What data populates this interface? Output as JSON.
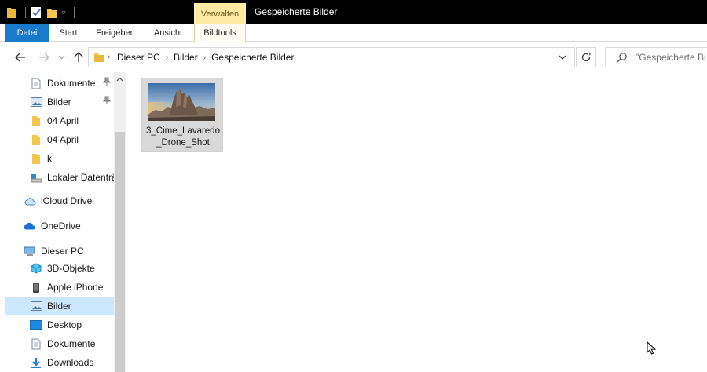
{
  "window": {
    "title": "Gespeicherte Bilder",
    "context_tab": "Verwalten",
    "accent_color": "#1979ca",
    "context_tab_color": "#ffeaa3",
    "selected_nav_color": "#cce8ff"
  },
  "ribbon": {
    "tabs": [
      {
        "label": "Datei",
        "icon": "none"
      },
      {
        "label": "Start",
        "icon": "none"
      },
      {
        "label": "Freigeben",
        "icon": "none"
      },
      {
        "label": "Ansicht",
        "icon": "none"
      },
      {
        "label": "Bildtools",
        "icon": "none"
      }
    ]
  },
  "address": {
    "breadcrumbs": [
      "Dieser PC",
      "Bilder",
      "Gespeicherte Bilder"
    ]
  },
  "search": {
    "placeholder": "\"Gespeicherte Bilder\" durchsuchen"
  },
  "sidebar": {
    "items": [
      {
        "label": "Dokumente",
        "icon": "documents-icon",
        "pinned": true
      },
      {
        "label": "Bilder",
        "icon": "pictures-icon",
        "pinned": true
      },
      {
        "label": "04 April",
        "icon": "folder-icon",
        "pinned": false
      },
      {
        "label": "04 April",
        "icon": "folder-icon",
        "pinned": false
      },
      {
        "label": "k",
        "icon": "folder-icon",
        "pinned": false
      },
      {
        "label": "Lokaler Datenträger",
        "icon": "drive-icon",
        "pinned": false
      },
      {
        "label": "iCloud Drive",
        "icon": "icloud-icon",
        "pinned": false
      },
      {
        "label": "OneDrive",
        "icon": "onedrive-icon",
        "pinned": false
      },
      {
        "label": "Dieser PC",
        "icon": "computer-icon",
        "pinned": false
      },
      {
        "label": "3D-Objekte",
        "icon": "3d-objects-icon",
        "pinned": false
      },
      {
        "label": "Apple iPhone",
        "icon": "phone-icon",
        "pinned": false
      },
      {
        "label": "Bilder",
        "icon": "pictures-icon",
        "pinned": false,
        "selected": true
      },
      {
        "label": "Desktop",
        "icon": "desktop-icon",
        "pinned": false
      },
      {
        "label": "Dokumente",
        "icon": "documents-icon",
        "pinned": false
      },
      {
        "label": "Downloads",
        "icon": "downloads-icon",
        "pinned": false
      }
    ]
  },
  "files": [
    {
      "name": "3_Cime_Lavaredo_Drone_Shot",
      "display_name": "3_Cime_Lavaredo _Drone_Shot",
      "icon": "image-thumbnail"
    }
  ]
}
